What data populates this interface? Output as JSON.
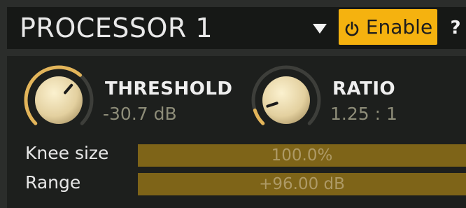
{
  "header": {
    "title": "PROCESSOR 1",
    "menu_icon": "triangle-down-icon",
    "enable_label": "Enable",
    "enable_icon": "power-icon",
    "help_label": "?"
  },
  "threshold": {
    "name": "THRESHOLD",
    "value": "-30.7 dB",
    "knob_level": 0.65
  },
  "ratio": {
    "name": "RATIO",
    "value": "1.25 : 1",
    "knob_level": 0.1
  },
  "knee_size": {
    "label": "Knee size",
    "value": "100.0%",
    "level": 1.0
  },
  "range": {
    "label": "Range",
    "value": "+96.00 dB",
    "level": 1.0
  },
  "colors": {
    "accent": "#f5b20f",
    "knob_arc": "#e3b55a",
    "slider_fill": "#7e6418",
    "value_text": "#8d8c78"
  }
}
